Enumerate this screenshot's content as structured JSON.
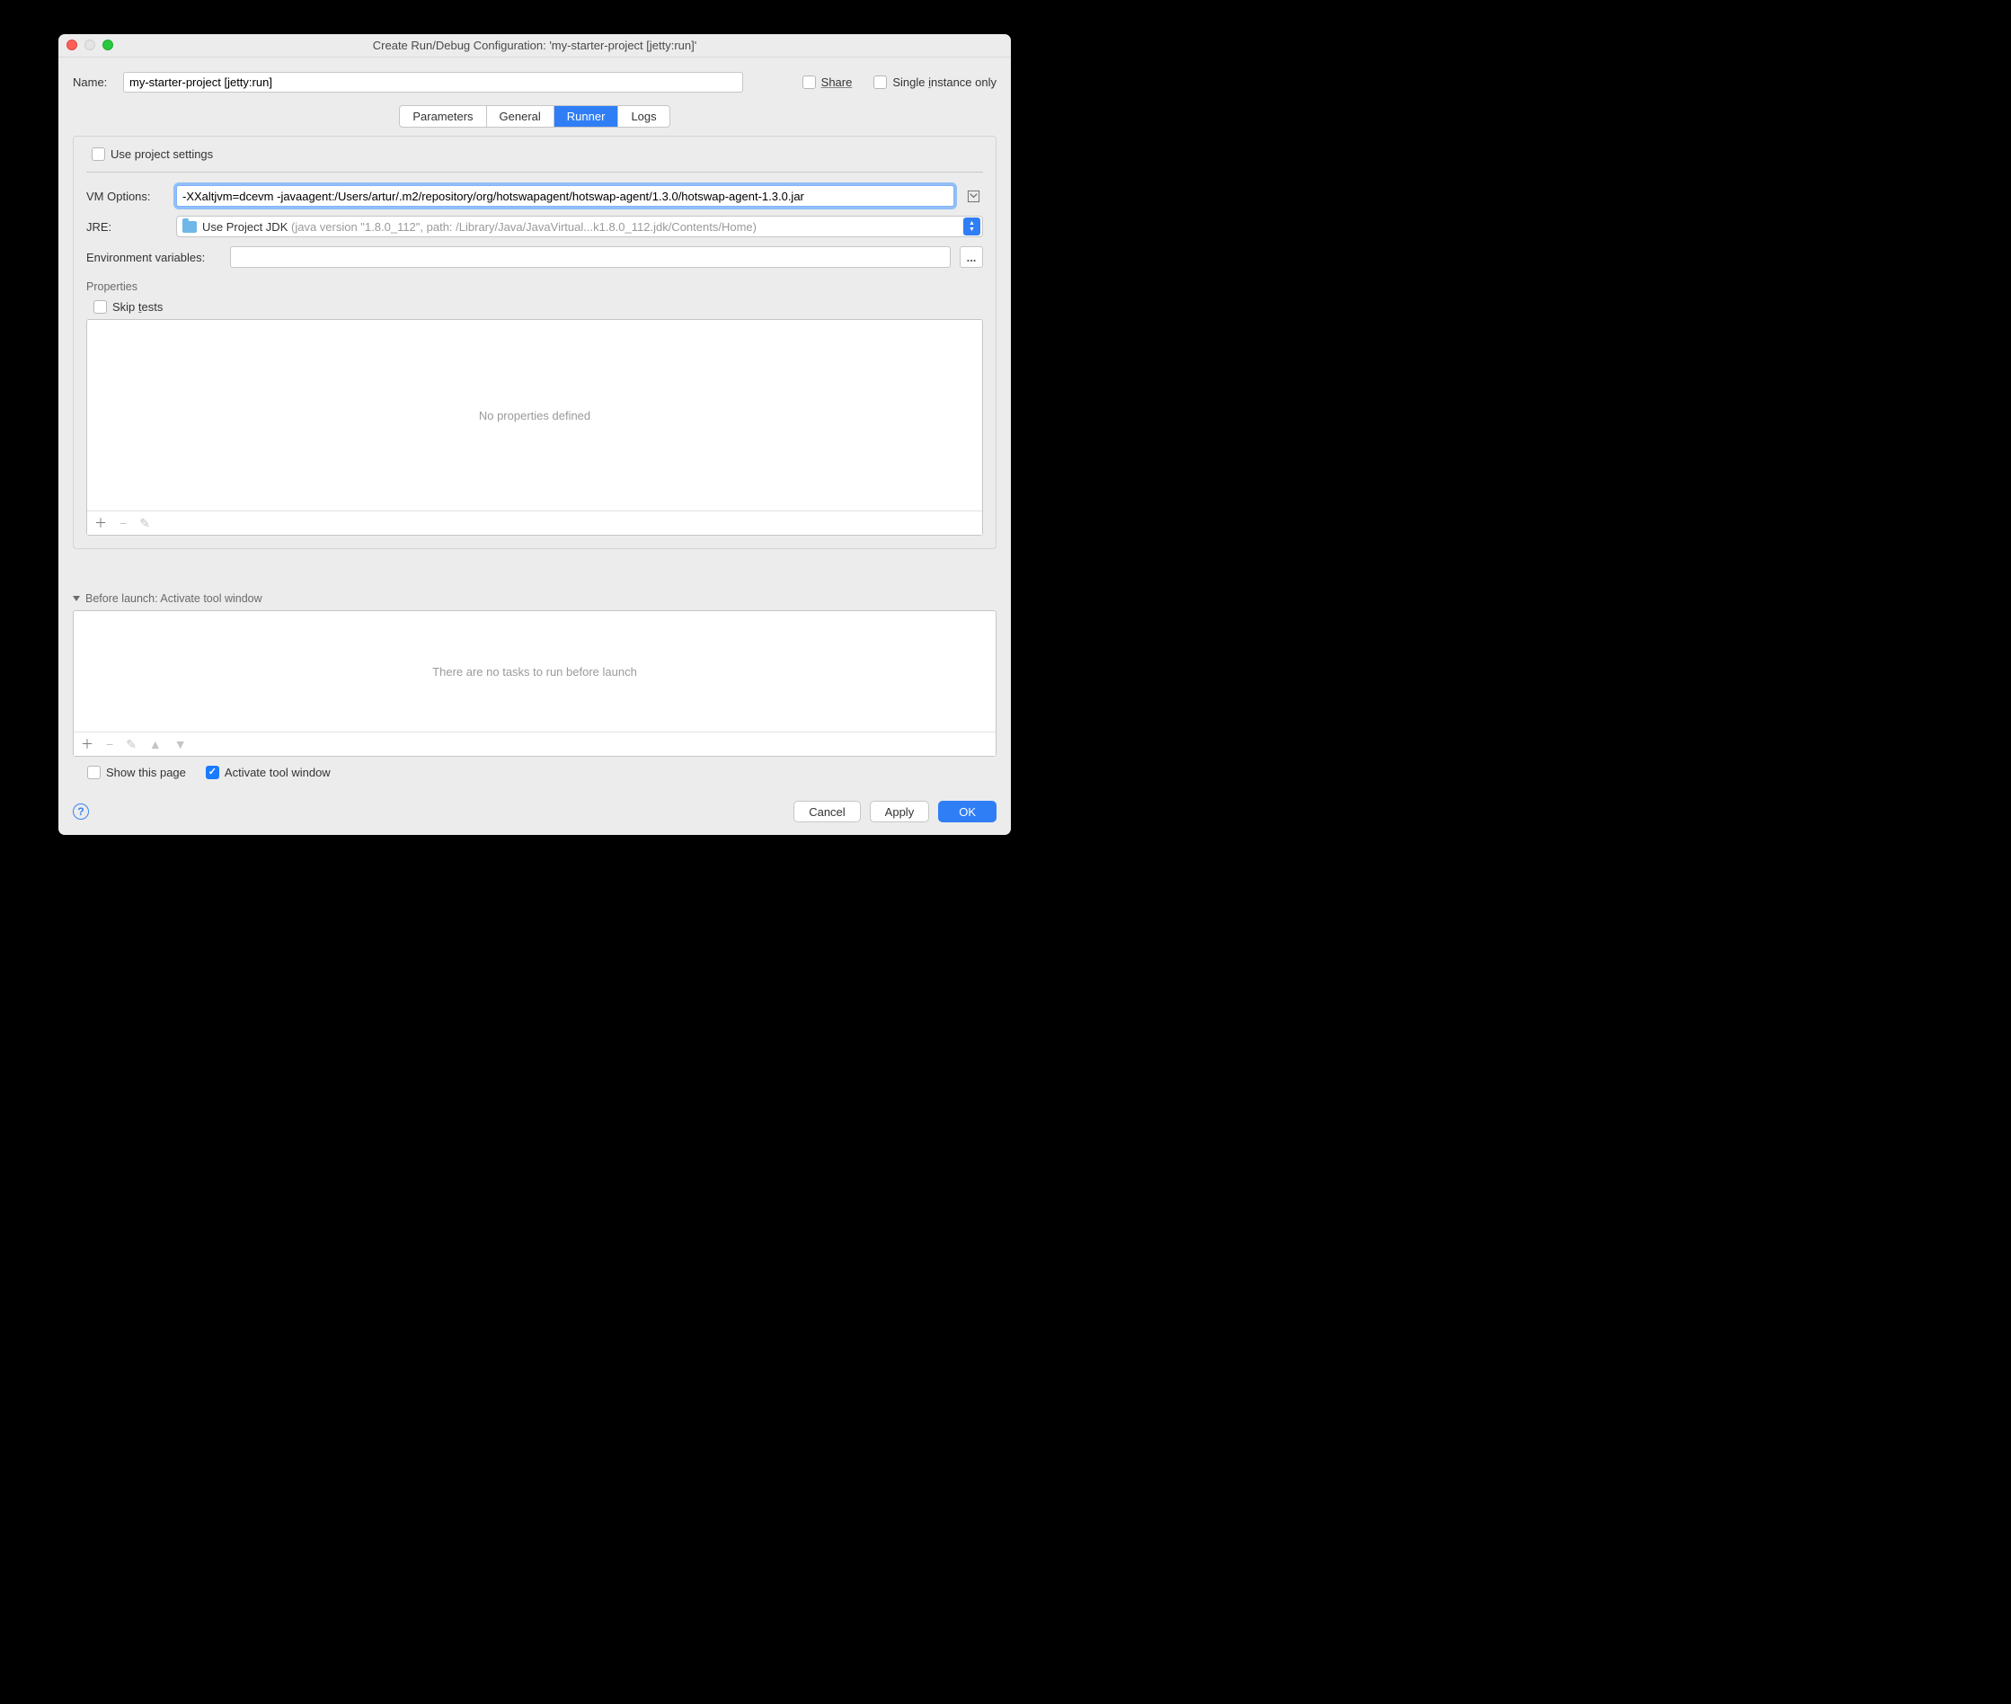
{
  "titlebar": {
    "title": "Create Run/Debug Configuration: 'my-starter-project [jetty:run]'"
  },
  "name_row": {
    "label": "Name:",
    "value": "my-starter-project [jetty:run]"
  },
  "top_checks": {
    "share": "Share",
    "single_instance": "Single instance only"
  },
  "tabs": {
    "parameters": "Parameters",
    "general": "General",
    "runner": "Runner",
    "logs": "Logs"
  },
  "runner": {
    "use_project_settings": "Use project settings",
    "vm_label": "VM Options:",
    "vm_value": "-XXaltjvm=dcevm -javaagent:/Users/artur/.m2/repository/org/hotswapagent/hotswap-agent/1.3.0/hotswap-agent-1.3.0.jar",
    "jre_label": "JRE:",
    "jre_primary": "Use Project JDK",
    "jre_secondary": "(java version \"1.8.0_112\", path: /Library/Java/JavaVirtual...k1.8.0_112.jdk/Contents/Home)",
    "env_label": "Environment variables:",
    "dots": "...",
    "properties_title": "Properties",
    "skip_tests": "Skip tests",
    "no_properties": "No properties defined"
  },
  "before": {
    "title": "Before launch: Activate tool window",
    "empty": "There are no tasks to run before launch",
    "show_this_page": "Show this page",
    "activate_tool_window": "Activate tool window"
  },
  "footer": {
    "cancel": "Cancel",
    "apply": "Apply",
    "ok": "OK"
  }
}
